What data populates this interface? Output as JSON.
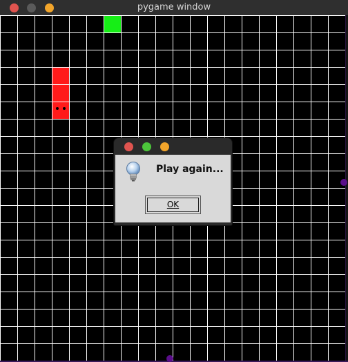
{
  "window": {
    "title": "pygame window"
  },
  "game": {
    "colors": {
      "snake": "#ff1a1a",
      "food": "#16ee16",
      "grid": "#ffffff",
      "background": "#000000"
    }
  },
  "dialog": {
    "message": "Play again...",
    "ok_label": "OK",
    "icon": "lightbulb-icon"
  }
}
